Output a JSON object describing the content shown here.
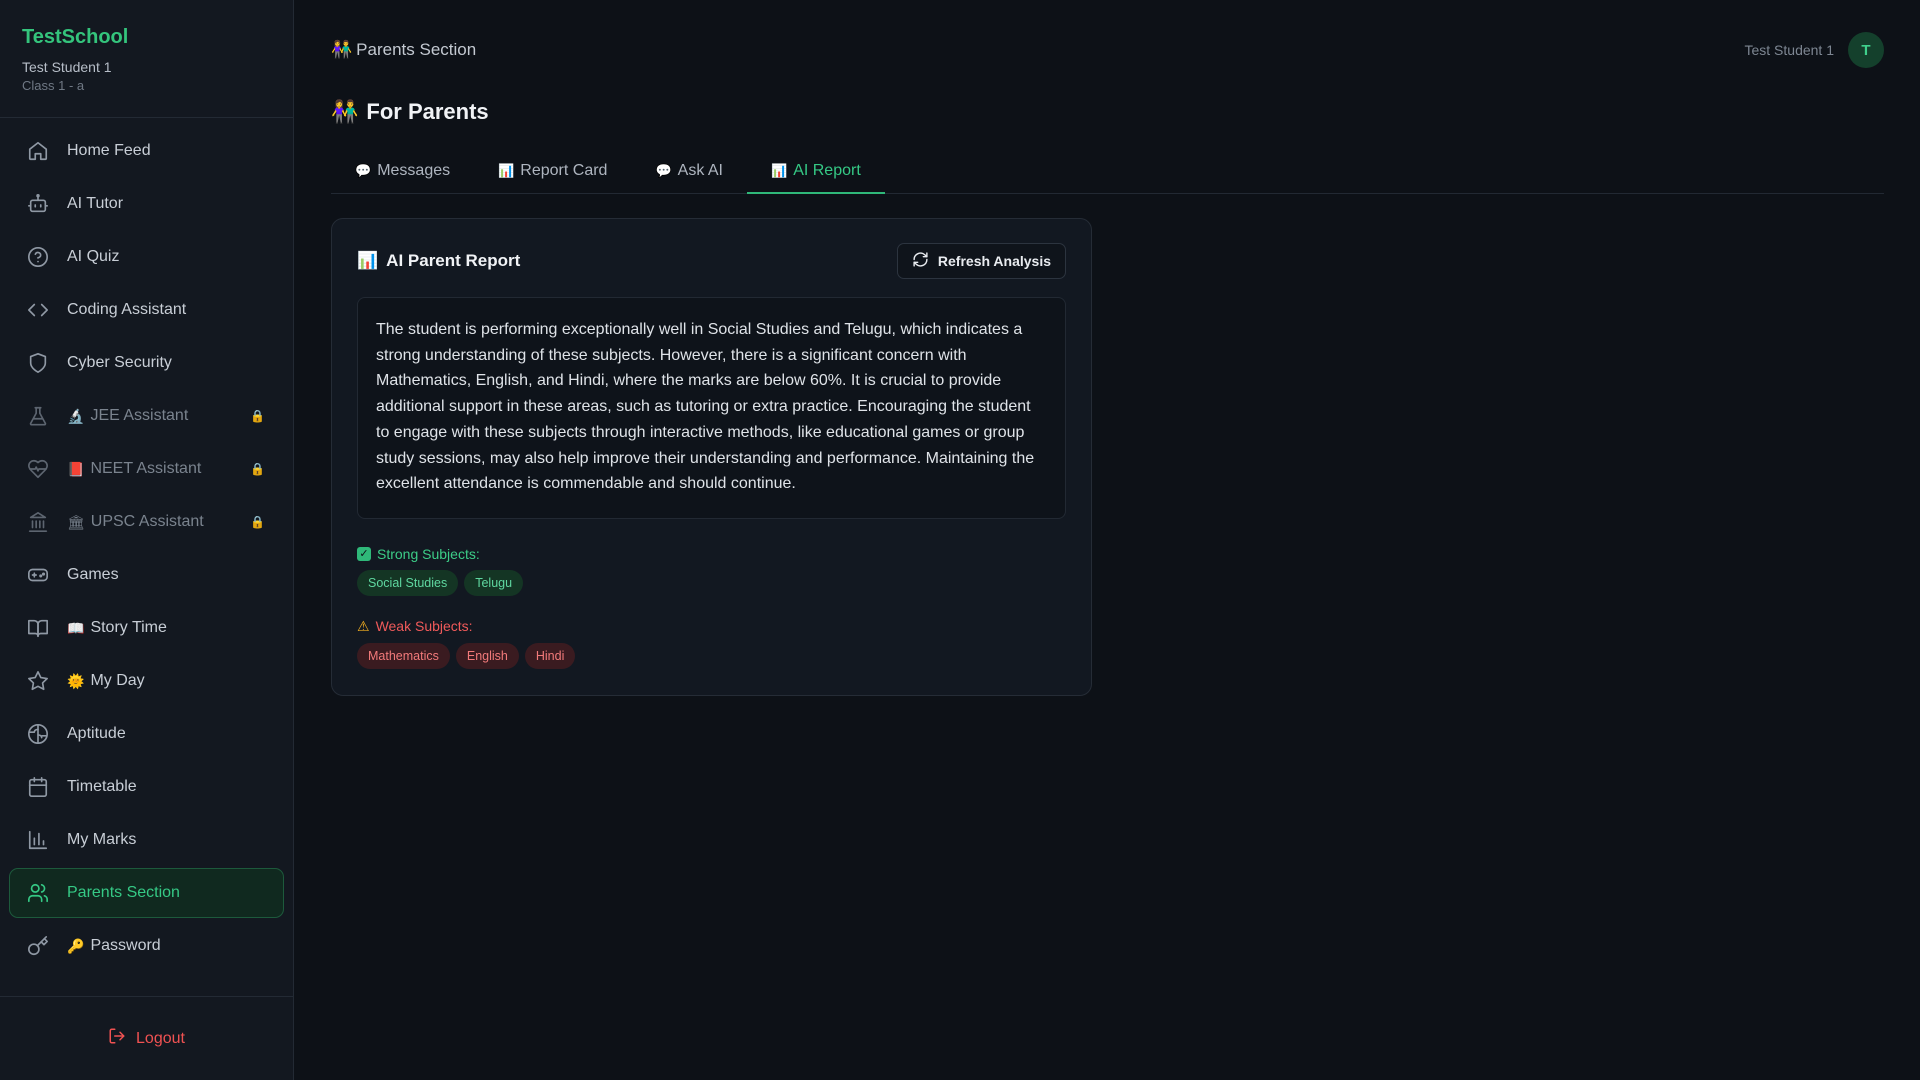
{
  "brand": {
    "name": "TestSchool",
    "student": "Test Student 1",
    "class": "Class 1 - a"
  },
  "sidebar": {
    "items": [
      {
        "label": "Home Feed",
        "icon": "home-icon"
      },
      {
        "label": "AI Tutor",
        "icon": "bot-icon"
      },
      {
        "label": "AI Quiz",
        "icon": "help-circle-icon"
      },
      {
        "label": "Coding Assistant",
        "icon": "code-icon"
      },
      {
        "label": "Cyber Security",
        "icon": "shield-icon"
      },
      {
        "label": "JEE Assistant",
        "icon": "flask-icon",
        "emoji": "🔬",
        "locked": true
      },
      {
        "label": "NEET Assistant",
        "icon": "heart-pulse-icon",
        "emoji": "📕",
        "locked": true
      },
      {
        "label": "UPSC Assistant",
        "icon": "landmark-icon",
        "emoji": "🏛",
        "locked": true
      },
      {
        "label": "Games",
        "icon": "gamepad-icon"
      },
      {
        "label": "Story Time",
        "icon": "book-icon",
        "emoji": "📖"
      },
      {
        "label": "My Day",
        "icon": "star-icon",
        "emoji": "🌞"
      },
      {
        "label": "Aptitude",
        "icon": "brain-icon"
      },
      {
        "label": "Timetable",
        "icon": "calendar-icon"
      },
      {
        "label": "My Marks",
        "icon": "bar-chart-icon"
      },
      {
        "label": "Parents Section",
        "icon": "users-icon",
        "active": true
      },
      {
        "label": "Password",
        "icon": "key-icon",
        "emoji": "🔑"
      }
    ],
    "lock_glyph": "🔒",
    "logout_label": "Logout"
  },
  "header": {
    "breadcrumb_icon": "👫",
    "breadcrumb": "Parents Section",
    "user_name": "Test Student 1",
    "avatar_letter": "T"
  },
  "page": {
    "title_icon": "👫",
    "title": "For Parents"
  },
  "tabs": [
    {
      "icon": "💬",
      "label": "Messages"
    },
    {
      "icon": "📊",
      "label": "Report Card"
    },
    {
      "icon": "💬",
      "label": "Ask AI"
    },
    {
      "icon": "📊",
      "label": "AI Report",
      "active": true
    }
  ],
  "report": {
    "title_icon": "📊",
    "title": "AI Parent Report",
    "refresh_label": "Refresh Analysis",
    "text": "The student is performing exceptionally well in Social Studies and Telugu, which indicates a strong understanding of these subjects. However, there is a significant concern with Mathematics, English, and Hindi, where the marks are below 60%. It is crucial to provide additional support in these areas, such as tutoring or extra practice. Encouraging the student to engage with these subjects through interactive methods, like educational games or group study sessions, may also help improve their understanding and performance. Maintaining the excellent attendance is commendable and should continue.",
    "strong_label": "Strong Subjects:",
    "strong_subjects": [
      "Social Studies",
      "Telugu"
    ],
    "weak_label": "Weak Subjects:",
    "weak_subjects": [
      "Mathematics",
      "English",
      "Hindi"
    ]
  },
  "colors": {
    "accent": "#35c985",
    "danger": "#f05252",
    "background": "#0d1117",
    "sidebar": "#131820"
  }
}
